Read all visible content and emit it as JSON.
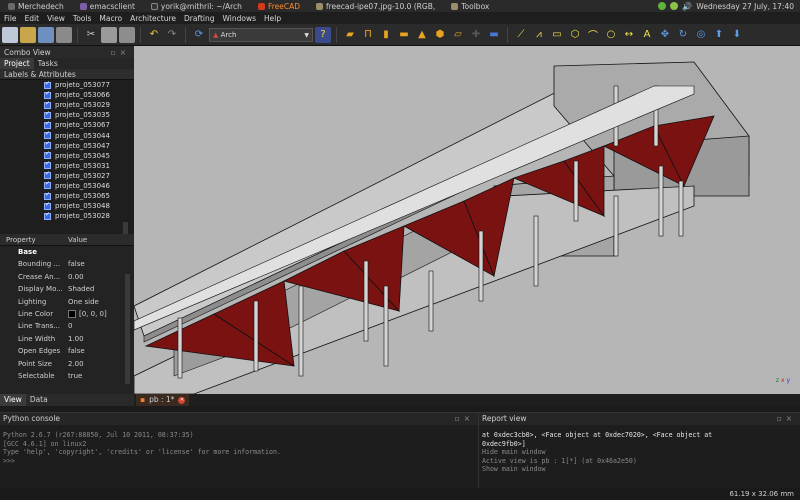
{
  "taskbar": {
    "tasks": [
      "Merchedech",
      "emacsclient",
      "yorik@mithril: ~/Arch",
      "FreeCAD",
      "freecad-ipe07.jpg-10.0 (RGB,",
      "Toolbox"
    ],
    "clock": "Wednesday 27 July, 17:40"
  },
  "menu": [
    "File",
    "Edit",
    "View",
    "Tools",
    "Macro",
    "Architecture",
    "Drafting",
    "Windows",
    "Help"
  ],
  "toolbar": {
    "workbench": "Arch"
  },
  "combo": {
    "title": "Combo View",
    "tabs": [
      "Project",
      "Tasks"
    ],
    "tree_header": "Labels & Attributes",
    "items": [
      "projeto_053077",
      "projeto_053066",
      "projeto_053029",
      "projeto_053035",
      "projeto_053067",
      "projeto_053044",
      "projeto_053047",
      "projeto_053045",
      "projeto_053031",
      "projeto_053027",
      "projeto_053046",
      "projeto_053065",
      "projeto_053048",
      "projeto_053028"
    ],
    "prop_columns": [
      "Property",
      "Value"
    ],
    "props": [
      {
        "k": "Base",
        "v": ""
      },
      {
        "k": "Bounding ...",
        "v": "false"
      },
      {
        "k": "Crease An...",
        "v": "0.00"
      },
      {
        "k": "Display Mo...",
        "v": "Shaded"
      },
      {
        "k": "Lighting",
        "v": "One side"
      },
      {
        "k": "Line Color",
        "v": "[0, 0, 0]"
      },
      {
        "k": "Line Trans...",
        "v": "0"
      },
      {
        "k": "Line Width",
        "v": "1.00"
      },
      {
        "k": "Open Edges",
        "v": "false"
      },
      {
        "k": "Point Size",
        "v": "2.00"
      },
      {
        "k": "Selectable",
        "v": "true"
      }
    ],
    "bottom_tabs": [
      "View",
      "Data"
    ]
  },
  "doc_tab": "pb : 1*",
  "python": {
    "title": "Python console",
    "lines": [
      "Python 2.6.7 (r267:88850, Jul 10 2011, 08:37:35)",
      "[GCC 4.6.1] on linux2",
      "Type 'help', 'copyright', 'credits' or 'license' for more information.",
      ">>> "
    ]
  },
  "report": {
    "title": "Report view",
    "lines": [
      "at 0xdec3cb0>, <Face object at 0xdec7020>, <Face object at",
      "0xdec9fb0>]",
      "Hide main window",
      "Active view is pb : 1[*] (at 0x46a2e50)",
      "Show main window"
    ]
  },
  "status": "61.19 x 32.06 mm",
  "axis_labels": {
    "x": "x",
    "y": "y",
    "z": "z"
  },
  "colors": {
    "view_bg": "#b6b6b6",
    "roof": "#7a1212",
    "checkbox": "#3968e0"
  }
}
